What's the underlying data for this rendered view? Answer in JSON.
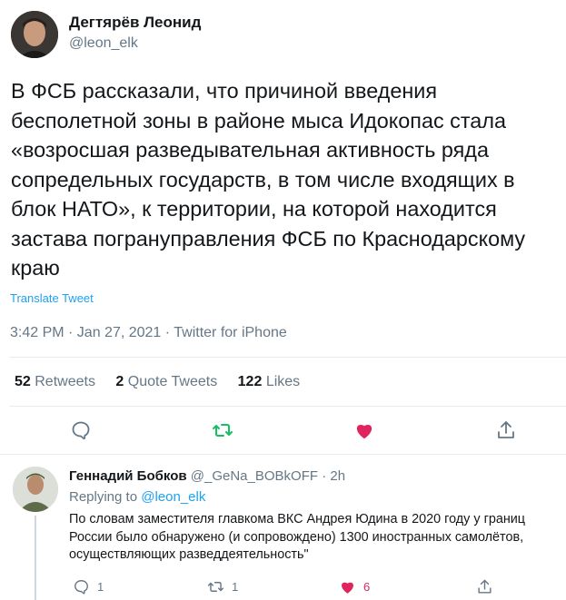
{
  "tweet": {
    "author_name": "Дегтярёв Леонид",
    "author_handle": "@leon_elk",
    "text": "В ФСБ рассказали, что причиной введения бесполетной зоны в районе мыса Идокопас стала «возросшая разведывательная активность ряда сопредельных государств, в том числе входящих в блок НАТО», к территории, на которой находится застава погрануправления ФСБ по Краснодарскому краю",
    "translate_label": "Translate Tweet",
    "meta": "3:42 PM · Jan 27, 2021 · Twitter for iPhone",
    "stats": {
      "retweets_count": "52",
      "retweets_label": "Retweets",
      "quotes_count": "2",
      "quotes_label": "Quote Tweets",
      "likes_count": "122",
      "likes_label": "Likes"
    },
    "icons": [
      "reply-icon",
      "retweet-icon",
      "like-icon",
      "share-icon"
    ]
  },
  "reply": {
    "author_name": "Геннадий Бобков",
    "author_handle": "@_GeNa_BOBkOFF",
    "separator": "·",
    "time": "2h",
    "replying_label": "Replying to",
    "replying_to": "@leon_elk",
    "text": "По словам заместителя главкома ВКС Андрея Юдина в 2020 году у границ России было обнаружено (и сопровождено) 1300 иностранных самолётов, осуществляющих разведдеятельность\"",
    "actions": {
      "reply_count": "1",
      "retweet_count": "1",
      "like_count": "6"
    }
  },
  "colors": {
    "accent": "#1da1f2",
    "retweet_green": "#17bf63",
    "like_red": "#e0245e",
    "secondary_text": "#657786",
    "divider": "#e6ecf0"
  }
}
